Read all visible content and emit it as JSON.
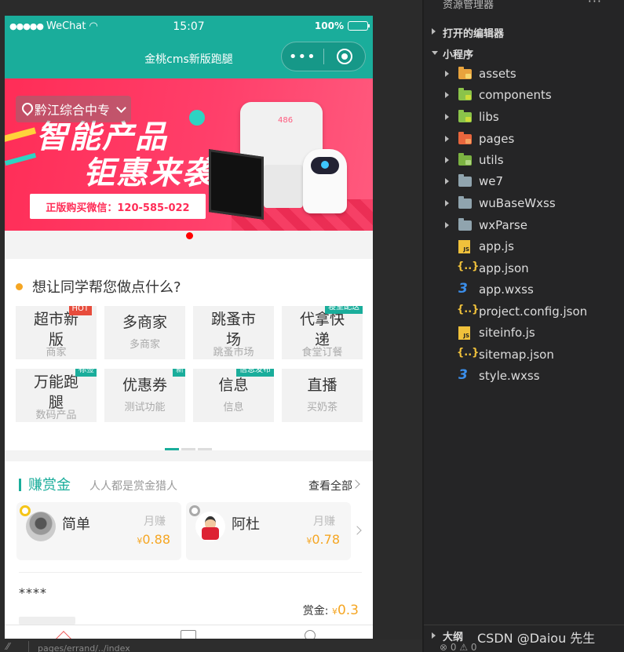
{
  "status_bar": {
    "carrier": "WeChat",
    "time": "15:07",
    "battery": "100%"
  },
  "nav": {
    "title": "金桃cms新版跑腿",
    "more": "•••"
  },
  "banner": {
    "location": "黔江综合中专",
    "headline1": "智能产品",
    "headline2": "钜惠来袭",
    "buyline": "正版购买微信：120-585-022",
    "scale_display": "486"
  },
  "service": {
    "question": "想让同学帮您做点什么?",
    "items": [
      {
        "name": "超市新版",
        "sub": "商家",
        "tag": "HOT"
      },
      {
        "name": "多商家",
        "sub": "多商家",
        "tag": ""
      },
      {
        "name": "跳蚤市场",
        "sub": "跳蚤市场",
        "tag": ""
      },
      {
        "name": "代拿快递",
        "sub": "食堂订餐",
        "tag": "寝室配送"
      },
      {
        "name": "万能跑腿",
        "sub": "数码产品",
        "tag": "标签"
      },
      {
        "name": "优惠券",
        "sub": "测试功能",
        "tag": "新"
      },
      {
        "name": "信息",
        "sub": "信息",
        "tag": "信息发布"
      },
      {
        "name": "直播",
        "sub": "买奶茶",
        "tag": ""
      }
    ]
  },
  "bounty": {
    "title": "赚赏金",
    "subtitle": "人人都是赏金猎人",
    "view_all": "查看全部",
    "cards": [
      {
        "name": "简单",
        "label": "月赚",
        "currency": "¥",
        "amount": "0.88"
      },
      {
        "name": "阿杜",
        "label": "月赚",
        "currency": "¥",
        "amount": "0.78"
      }
    ],
    "task": {
      "title": "****",
      "reward_label": "赏金:",
      "currency": "¥",
      "reward": "0.3"
    }
  },
  "devtools": {
    "path": "pages/errand/../index"
  },
  "explorer": {
    "title": "资源管理器",
    "more": "···",
    "open_editors": "打开的编辑器",
    "project": "小程序",
    "folders": [
      {
        "name": "assets",
        "color": "#e8a33d",
        "badge": "#f5d76e"
      },
      {
        "name": "components",
        "color": "#8bc34a",
        "badge": "#cddc39"
      },
      {
        "name": "libs",
        "color": "#8bc34a",
        "badge": "#cddc39"
      },
      {
        "name": "pages",
        "color": "#e8663d",
        "badge": "#f4a261"
      },
      {
        "name": "utils",
        "color": "#7cb342",
        "badge": "#aed581"
      },
      {
        "name": "we7",
        "color": "#90a4ae",
        "badge": ""
      },
      {
        "name": "wuBaseWxss",
        "color": "#90a4ae",
        "badge": ""
      },
      {
        "name": "wxParse",
        "color": "#90a4ae",
        "badge": ""
      }
    ],
    "files": [
      {
        "name": "app.js",
        "kind": "js"
      },
      {
        "name": "app.json",
        "kind": "json"
      },
      {
        "name": "app.wxss",
        "kind": "wxss"
      },
      {
        "name": "project.config.json",
        "kind": "json"
      },
      {
        "name": "siteinfo.js",
        "kind": "js"
      },
      {
        "name": "sitemap.json",
        "kind": "json"
      },
      {
        "name": "style.wxss",
        "kind": "wxss"
      }
    ],
    "outline": "大纲",
    "watermark": "CSDN @Daiou 先生",
    "problems": "⊗ 0 ⚠ 0"
  }
}
